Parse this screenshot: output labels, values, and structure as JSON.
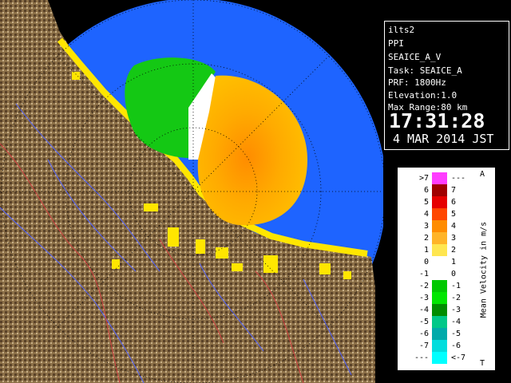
{
  "info": {
    "site": "ilts2",
    "scan_type": "PPI",
    "product": "SEAICE_A_V",
    "task": "Task: SEAICE_A",
    "prf": "PRF: 1800Hz",
    "elevation": "Elevation:1.0",
    "max_range": "Max Range:80 km",
    "time": "17:31:28",
    "date": "4 MAR 2014 JST"
  },
  "legend": {
    "title": "Mean Velocity in m/s",
    "top_letter": "A",
    "bottom_letter": "T",
    "left_labels": [
      ">7",
      "6",
      "5",
      "4",
      "3",
      "2",
      "1",
      "0",
      "-1",
      "-2",
      "-3",
      "-4",
      "-5",
      "-6",
      "-7",
      "---"
    ],
    "right_labels": [
      "---",
      "7",
      "6",
      "5",
      "4",
      "3",
      "2",
      "1",
      "0",
      "-1",
      "-2",
      "-3",
      "-4",
      "-5",
      "-6",
      "<-7"
    ],
    "colors": [
      "#ff3cff",
      "#a00000",
      "#e60000",
      "#ff4600",
      "#ff8c00",
      "#ffb428",
      "#ffe650",
      "#ffffff",
      "#ffffff",
      "#00c800",
      "#00e600",
      "#008c00",
      "#00c888",
      "#00aaaa",
      "#00dddd",
      "#00ffff"
    ]
  },
  "map": {
    "background_color": "#000000",
    "range_disc_color": "#1e64ff",
    "terrain_color": "#8c7048",
    "coast_echo_color": "#ffe600",
    "approaching_color": "#14c814",
    "receding_color": "#ffaa00"
  }
}
